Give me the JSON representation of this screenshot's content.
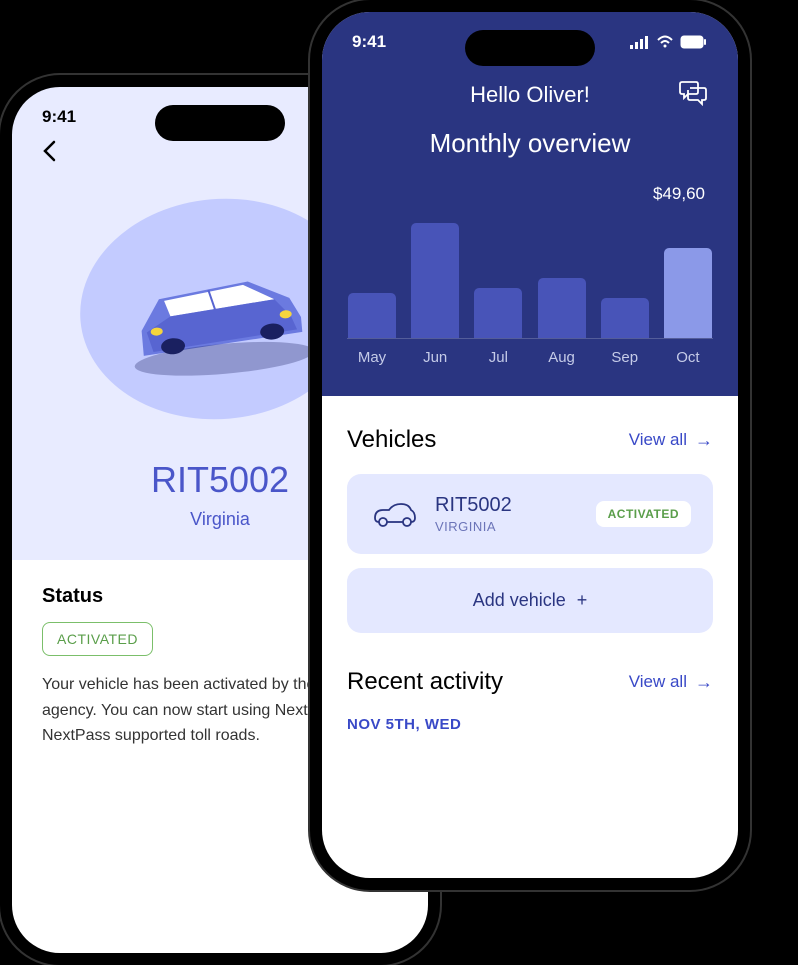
{
  "status_bar": {
    "time": "9:41"
  },
  "phone1": {
    "plate": "RIT5002",
    "region": "Virginia",
    "status_label": "Status",
    "status_value": "ACTIVATED",
    "status_description": "Your vehicle has been activated by the tolling agency. You can now start using NextPass on all NextPass supported toll roads."
  },
  "phone2": {
    "greeting": "Hello Oliver!",
    "overview_title": "Monthly overview",
    "highlight_value": "$49,60",
    "chart_data": {
      "type": "bar",
      "categories": [
        "May",
        "Jun",
        "Jul",
        "Aug",
        "Sep",
        "Oct"
      ],
      "values": [
        45,
        115,
        50,
        60,
        40,
        90
      ],
      "highlight_index": 5,
      "title": "Monthly overview",
      "ylim": [
        0,
        130
      ]
    },
    "vehicles": {
      "title": "Vehicles",
      "view_all": "View all",
      "items": [
        {
          "plate": "RIT5002",
          "region": "VIRGINIA",
          "status": "ACTIVATED"
        }
      ],
      "add_label": "Add vehicle"
    },
    "recent": {
      "title": "Recent activity",
      "view_all": "View all",
      "date": "NOV 5TH, WED"
    }
  }
}
